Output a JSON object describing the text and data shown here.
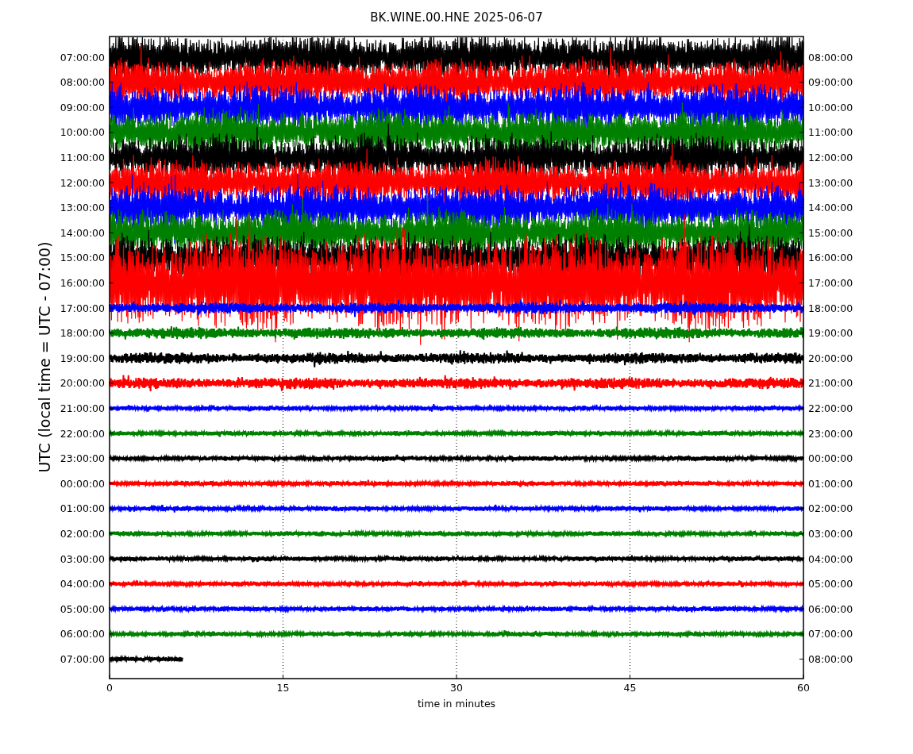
{
  "title": "BK.WINE.00.HNE 2025-06-07",
  "plot": {
    "xlabel": "time in minutes",
    "ylabel": "UTC (local time = UTC - 07:00)",
    "xticks": [
      "0",
      "15",
      "30",
      "45",
      "60"
    ],
    "rows": [
      {
        "left": "07:00:00",
        "right": "08:00:00",
        "color": "#000000",
        "kind": "strong"
      },
      {
        "left": "08:00:00",
        "right": "09:00:00",
        "color": "#ff0000",
        "kind": "strong"
      },
      {
        "left": "09:00:00",
        "right": "10:00:00",
        "color": "#0000ff",
        "kind": "strong"
      },
      {
        "left": "10:00:00",
        "right": "11:00:00",
        "color": "#008000",
        "kind": "strong"
      },
      {
        "left": "11:00:00",
        "right": "12:00:00",
        "color": "#000000",
        "kind": "strong"
      },
      {
        "left": "12:00:00",
        "right": "13:00:00",
        "color": "#ff0000",
        "kind": "strong"
      },
      {
        "left": "13:00:00",
        "right": "14:00:00",
        "color": "#0000ff",
        "kind": "strong"
      },
      {
        "left": "14:00:00",
        "right": "15:00:00",
        "color": "#008000",
        "kind": "strong"
      },
      {
        "left": "15:00:00",
        "right": "16:00:00",
        "color": "#000000",
        "kind": "strong"
      },
      {
        "left": "16:00:00",
        "right": "17:00:00",
        "color": "#ff0000",
        "kind": "very-strong"
      },
      {
        "left": "17:00:00",
        "right": "18:00:00",
        "color": "#0000ff",
        "kind": "moderate"
      },
      {
        "left": "18:00:00",
        "right": "19:00:00",
        "color": "#008000",
        "kind": "moderate"
      },
      {
        "left": "19:00:00",
        "right": "20:00:00",
        "color": "#000000",
        "kind": "moderate"
      },
      {
        "left": "20:00:00",
        "right": "21:00:00",
        "color": "#ff0000",
        "kind": "moderate"
      },
      {
        "left": "21:00:00",
        "right": "22:00:00",
        "color": "#0000ff",
        "kind": "quiet"
      },
      {
        "left": "22:00:00",
        "right": "23:00:00",
        "color": "#008000",
        "kind": "quiet"
      },
      {
        "left": "23:00:00",
        "right": "00:00:00",
        "color": "#000000",
        "kind": "quiet"
      },
      {
        "left": "00:00:00",
        "right": "01:00:00",
        "color": "#ff0000",
        "kind": "quiet"
      },
      {
        "left": "01:00:00",
        "right": "02:00:00",
        "color": "#0000ff",
        "kind": "quiet"
      },
      {
        "left": "02:00:00",
        "right": "03:00:00",
        "color": "#008000",
        "kind": "quiet"
      },
      {
        "left": "03:00:00",
        "right": "04:00:00",
        "color": "#000000",
        "kind": "quiet"
      },
      {
        "left": "04:00:00",
        "right": "05:00:00",
        "color": "#ff0000",
        "kind": "quiet"
      },
      {
        "left": "05:00:00",
        "right": "06:00:00",
        "color": "#0000ff",
        "kind": "quiet"
      },
      {
        "left": "06:00:00",
        "right": "07:00:00",
        "color": "#008000",
        "kind": "quiet"
      },
      {
        "left": "07:00:00",
        "right": "08:00:00",
        "color": "#000000",
        "kind": "partial"
      }
    ]
  }
}
